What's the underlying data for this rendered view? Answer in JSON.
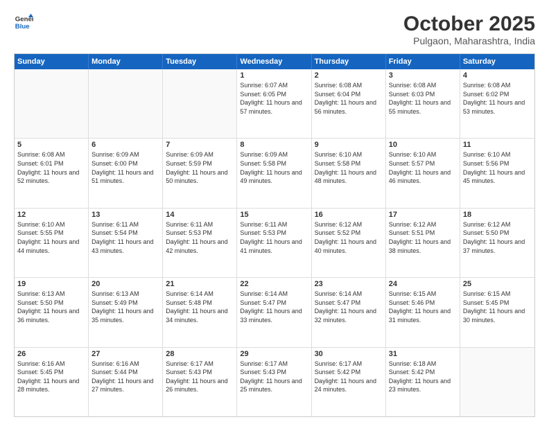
{
  "header": {
    "logo_line1": "General",
    "logo_line2": "Blue",
    "title": "October 2025",
    "subtitle": "Pulgaon, Maharashtra, India"
  },
  "weekdays": [
    "Sunday",
    "Monday",
    "Tuesday",
    "Wednesday",
    "Thursday",
    "Friday",
    "Saturday"
  ],
  "weeks": [
    [
      {
        "day": "",
        "empty": true
      },
      {
        "day": "",
        "empty": true
      },
      {
        "day": "",
        "empty": true
      },
      {
        "day": "1",
        "sunrise": "6:07 AM",
        "sunset": "6:05 PM",
        "daylight": "11 hours and 57 minutes."
      },
      {
        "day": "2",
        "sunrise": "6:08 AM",
        "sunset": "6:04 PM",
        "daylight": "11 hours and 56 minutes."
      },
      {
        "day": "3",
        "sunrise": "6:08 AM",
        "sunset": "6:03 PM",
        "daylight": "11 hours and 55 minutes."
      },
      {
        "day": "4",
        "sunrise": "6:08 AM",
        "sunset": "6:02 PM",
        "daylight": "11 hours and 53 minutes."
      }
    ],
    [
      {
        "day": "5",
        "sunrise": "6:08 AM",
        "sunset": "6:01 PM",
        "daylight": "11 hours and 52 minutes."
      },
      {
        "day": "6",
        "sunrise": "6:09 AM",
        "sunset": "6:00 PM",
        "daylight": "11 hours and 51 minutes."
      },
      {
        "day": "7",
        "sunrise": "6:09 AM",
        "sunset": "5:59 PM",
        "daylight": "11 hours and 50 minutes."
      },
      {
        "day": "8",
        "sunrise": "6:09 AM",
        "sunset": "5:58 PM",
        "daylight": "11 hours and 49 minutes."
      },
      {
        "day": "9",
        "sunrise": "6:10 AM",
        "sunset": "5:58 PM",
        "daylight": "11 hours and 48 minutes."
      },
      {
        "day": "10",
        "sunrise": "6:10 AM",
        "sunset": "5:57 PM",
        "daylight": "11 hours and 46 minutes."
      },
      {
        "day": "11",
        "sunrise": "6:10 AM",
        "sunset": "5:56 PM",
        "daylight": "11 hours and 45 minutes."
      }
    ],
    [
      {
        "day": "12",
        "sunrise": "6:10 AM",
        "sunset": "5:55 PM",
        "daylight": "11 hours and 44 minutes."
      },
      {
        "day": "13",
        "sunrise": "6:11 AM",
        "sunset": "5:54 PM",
        "daylight": "11 hours and 43 minutes."
      },
      {
        "day": "14",
        "sunrise": "6:11 AM",
        "sunset": "5:53 PM",
        "daylight": "11 hours and 42 minutes."
      },
      {
        "day": "15",
        "sunrise": "6:11 AM",
        "sunset": "5:53 PM",
        "daylight": "11 hours and 41 minutes."
      },
      {
        "day": "16",
        "sunrise": "6:12 AM",
        "sunset": "5:52 PM",
        "daylight": "11 hours and 40 minutes."
      },
      {
        "day": "17",
        "sunrise": "6:12 AM",
        "sunset": "5:51 PM",
        "daylight": "11 hours and 38 minutes."
      },
      {
        "day": "18",
        "sunrise": "6:12 AM",
        "sunset": "5:50 PM",
        "daylight": "11 hours and 37 minutes."
      }
    ],
    [
      {
        "day": "19",
        "sunrise": "6:13 AM",
        "sunset": "5:50 PM",
        "daylight": "11 hours and 36 minutes."
      },
      {
        "day": "20",
        "sunrise": "6:13 AM",
        "sunset": "5:49 PM",
        "daylight": "11 hours and 35 minutes."
      },
      {
        "day": "21",
        "sunrise": "6:14 AM",
        "sunset": "5:48 PM",
        "daylight": "11 hours and 34 minutes."
      },
      {
        "day": "22",
        "sunrise": "6:14 AM",
        "sunset": "5:47 PM",
        "daylight": "11 hours and 33 minutes."
      },
      {
        "day": "23",
        "sunrise": "6:14 AM",
        "sunset": "5:47 PM",
        "daylight": "11 hours and 32 minutes."
      },
      {
        "day": "24",
        "sunrise": "6:15 AM",
        "sunset": "5:46 PM",
        "daylight": "11 hours and 31 minutes."
      },
      {
        "day": "25",
        "sunrise": "6:15 AM",
        "sunset": "5:45 PM",
        "daylight": "11 hours and 30 minutes."
      }
    ],
    [
      {
        "day": "26",
        "sunrise": "6:16 AM",
        "sunset": "5:45 PM",
        "daylight": "11 hours and 28 minutes."
      },
      {
        "day": "27",
        "sunrise": "6:16 AM",
        "sunset": "5:44 PM",
        "daylight": "11 hours and 27 minutes."
      },
      {
        "day": "28",
        "sunrise": "6:17 AM",
        "sunset": "5:43 PM",
        "daylight": "11 hours and 26 minutes."
      },
      {
        "day": "29",
        "sunrise": "6:17 AM",
        "sunset": "5:43 PM",
        "daylight": "11 hours and 25 minutes."
      },
      {
        "day": "30",
        "sunrise": "6:17 AM",
        "sunset": "5:42 PM",
        "daylight": "11 hours and 24 minutes."
      },
      {
        "day": "31",
        "sunrise": "6:18 AM",
        "sunset": "5:42 PM",
        "daylight": "11 hours and 23 minutes."
      },
      {
        "day": "",
        "empty": true
      }
    ]
  ]
}
